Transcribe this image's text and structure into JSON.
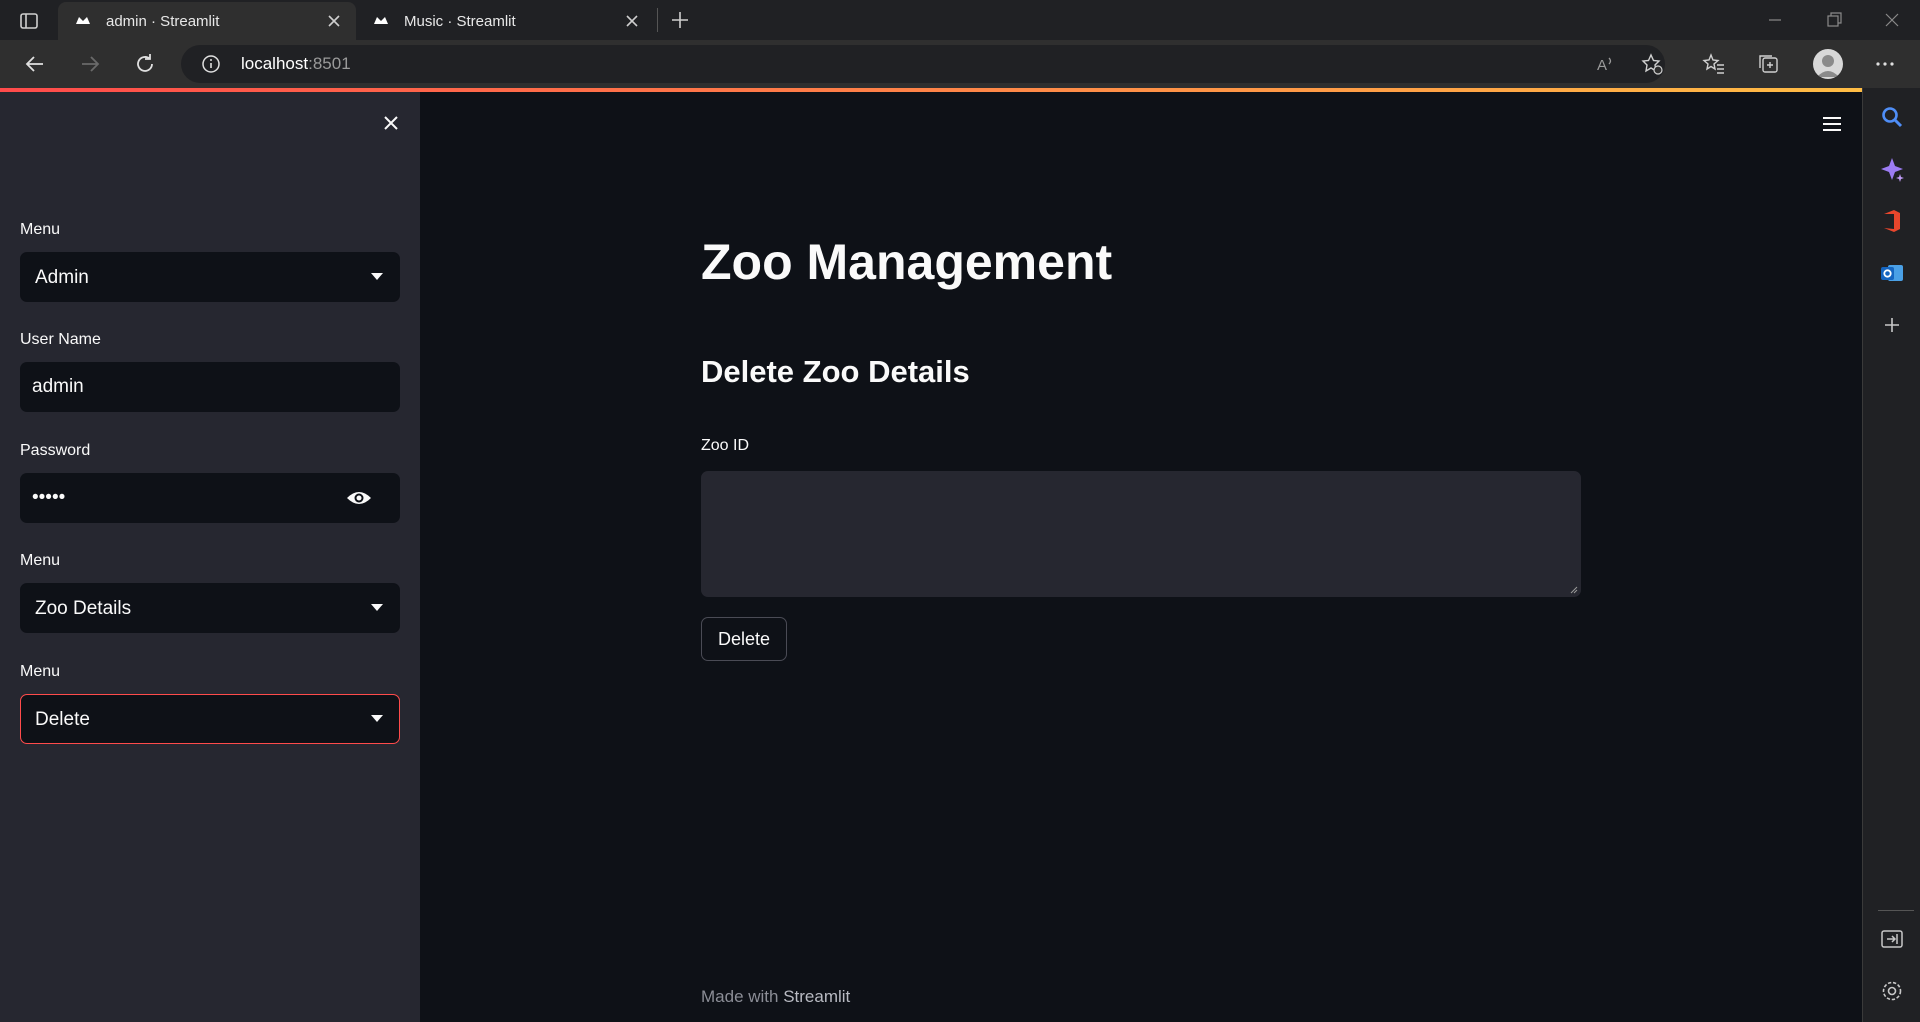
{
  "browser": {
    "tabs": [
      {
        "title": "admin · Streamlit",
        "active": true
      },
      {
        "title": "Music · Streamlit",
        "active": false
      }
    ],
    "address": {
      "host": "localhost",
      "port": ":8501"
    }
  },
  "sidebar": {
    "menu1": {
      "label": "Menu",
      "value": "Admin"
    },
    "username": {
      "label": "User Name",
      "value": "admin"
    },
    "password": {
      "label": "Password",
      "value": "•••••"
    },
    "menu2": {
      "label": "Menu",
      "value": "Zoo Details"
    },
    "menu3": {
      "label": "Menu",
      "value": "Delete"
    }
  },
  "main": {
    "title": "Zoo Management",
    "subheader": "Delete Zoo Details",
    "zoo_id_label": "Zoo ID",
    "delete_button": "Delete",
    "footer_prefix": "Made with ",
    "footer_brand": "Streamlit"
  },
  "colors": {
    "accent": "#ff4b4b",
    "background": "#0e1117",
    "sidebar": "#262730"
  }
}
